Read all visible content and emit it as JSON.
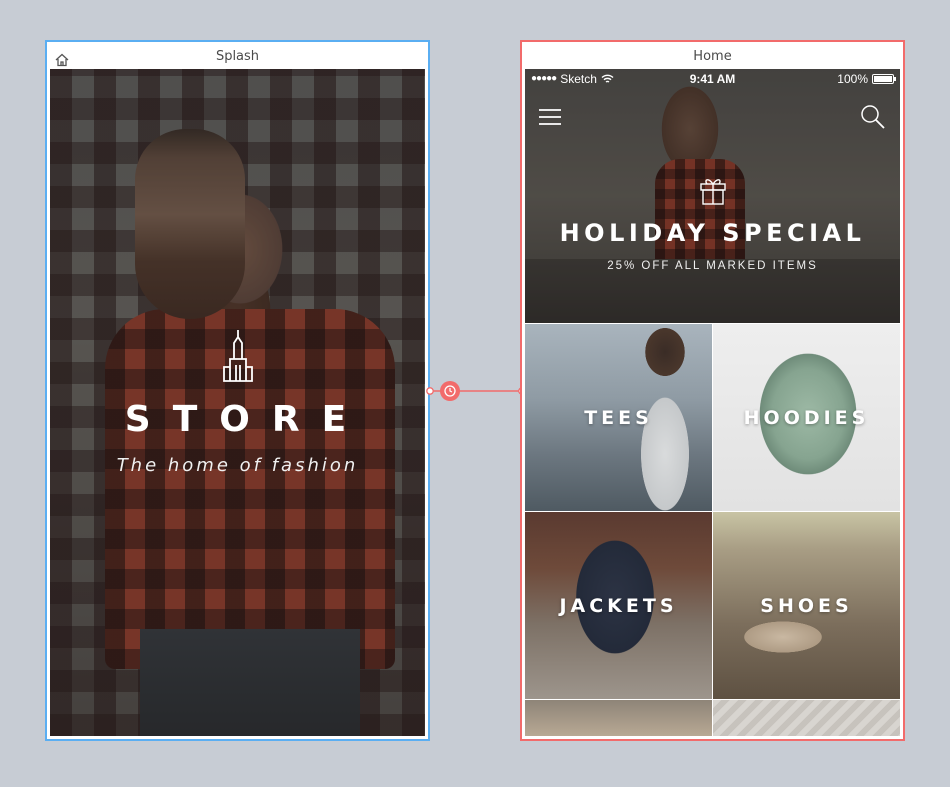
{
  "splash": {
    "artboard_title": "Splash",
    "brand": "STORE",
    "tagline": "The home of fashion"
  },
  "home": {
    "artboard_title": "Home",
    "status_bar": {
      "carrier": "Sketch",
      "time": "9:41 AM",
      "battery": "100%"
    },
    "hero": {
      "title": "HOLIDAY SPECIAL",
      "subtitle": "25% OFF ALL MARKED ITEMS"
    },
    "categories": [
      {
        "label": "TEES"
      },
      {
        "label": "HOODIES"
      },
      {
        "label": "JACKETS"
      },
      {
        "label": "SHOES"
      }
    ]
  },
  "colors": {
    "canvas": "#c7ccd4",
    "splash_border": "#5aaef2",
    "home_border": "#f26b6b",
    "link": "#f26b6b"
  },
  "icons": [
    "home-icon",
    "building-logo-icon",
    "hamburger-menu-icon",
    "search-icon",
    "gift-icon",
    "wifi-icon",
    "battery-icon",
    "link-timer-icon"
  ]
}
